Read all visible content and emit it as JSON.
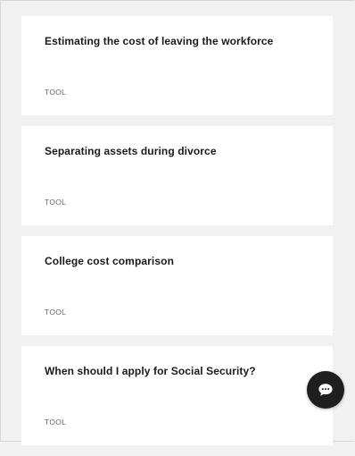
{
  "cards": [
    {
      "title": "Estimating the cost of leaving the workforce",
      "tag": "TOOL"
    },
    {
      "title": "Separating assets during divorce",
      "tag": "TOOL"
    },
    {
      "title": "College cost comparison",
      "tag": "TOOL"
    },
    {
      "title": "When should I apply for Social Security?",
      "tag": "TOOL"
    }
  ],
  "chat": {
    "icon": "chat-bubble-icon",
    "color": "#1f1f1f"
  },
  "colors": {
    "background": "#f1f1f1",
    "card": "#ffffff",
    "title": "#1a1a1a",
    "tag": "#666666"
  }
}
